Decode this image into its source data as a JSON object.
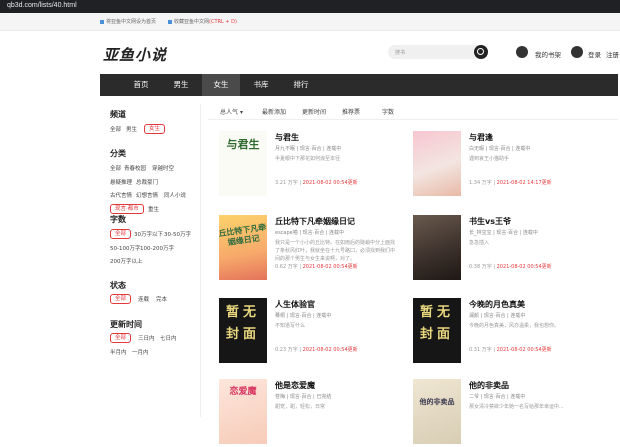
{
  "browser": {
    "url": "qb3d.com/lists/40.html"
  },
  "topbar": {
    "set_home": "将亚鱼中文网设为首页",
    "bookmark_prefix": "收藏亚鱼中文网",
    "bookmark_shortcut": "(CTRL + D)"
  },
  "header": {
    "logo": "亚鱼小说",
    "search_placeholder": "搜书",
    "shelf": "我的书架",
    "login": "登录",
    "register": "注册"
  },
  "nav": [
    "首页",
    "男生",
    "女生",
    "书库",
    "排行"
  ],
  "sidebar": {
    "channel_title": "频道",
    "channels": [
      "全部",
      "男生",
      "女生"
    ],
    "category_title": "分类",
    "categories": [
      "全部",
      "青春校园",
      "穿越时空",
      "悬疑推理",
      "总裁豪门",
      "古代言情",
      "幻想言情",
      "同人小说",
      "现言·都市",
      "重生"
    ],
    "words_title": "字数",
    "words": [
      "全部",
      "30万字以下",
      "30-50万字",
      "50-100万字",
      "100-200万字",
      "200万字以上"
    ],
    "status_title": "状态",
    "status": [
      "全部",
      "连载",
      "完本"
    ],
    "update_title": "更新时间",
    "updates": [
      "全部",
      "三日内",
      "七日内",
      "半月内",
      "一月内"
    ]
  },
  "sorts": [
    "总人气",
    "最新添加",
    "更新时间",
    "推荐票",
    "字数"
  ],
  "books": [
    {
      "title": "与君生",
      "meta": "月九不眠 | 现言·百合 | 连载中",
      "desc": "半夏眼中下那花如何浪至本径",
      "words": "3.21 万字",
      "updated": "2021-08-02 00:54更新",
      "cover_text": "与君生"
    },
    {
      "title": "与君逢",
      "meta": "白无暇 | 现言·百合 | 连载中",
      "desc": "遇到哀王小猫助手",
      "words": "1.34 万字",
      "updated": "2021-08-02 14:17更新",
      "cover_text": ""
    },
    {
      "title": "丘比特下凡牵姻缘日记",
      "meta": "escape喵 | 现言·百合 | 连载中",
      "desc": "我只是一个小小的丘比特。在如雨后的陡峭中分上面找了条秋风红叶，我就坐在十九号路口，必须找到我们中间的那个男生与女生来说啊，对了。",
      "words": "0.62 万字",
      "updated": "2021-08-02 00:54更新",
      "cover_text": "丘比特下凡牵姻缘日记"
    },
    {
      "title": "书生vs王爷",
      "meta": "长_林宝宝 | 现言·百合 | 连载中",
      "desc": "急急插入",
      "words": "0.38 万字",
      "updated": "2021-08-02 00:54更新",
      "cover_text": ""
    },
    {
      "title": "人生体验官",
      "meta": "蓦桐 | 现言·百合 | 连载中",
      "desc": "不知道写什么",
      "words": "0.23 万字",
      "updated": "2021-08-02 00:54更新",
      "cover_text": "暂无封面"
    },
    {
      "title": "今晚的月色真美",
      "meta": "澜颜 | 现言·百合 | 连载中",
      "desc": "今晚的月色真美，风亦温柔，我也想你。",
      "words": "0.31 万字",
      "updated": "2021-08-02 00:54更新",
      "cover_text": "暂无封面"
    },
    {
      "title": "他是恋爱魔",
      "meta": "苍梅 | 现言·百合 | 已完结",
      "desc": "甜宠，甜，轻松，日常",
      "words": "",
      "updated": "",
      "cover_text": "恋爱魔"
    },
    {
      "title": "他的非卖品",
      "meta": "二爷 | 现言·百合 | 连载中",
      "desc": "那女清冷禁欲少年她一名写给那年幸运中...",
      "words": "",
      "updated": "",
      "cover_text": "他的非卖品"
    }
  ]
}
